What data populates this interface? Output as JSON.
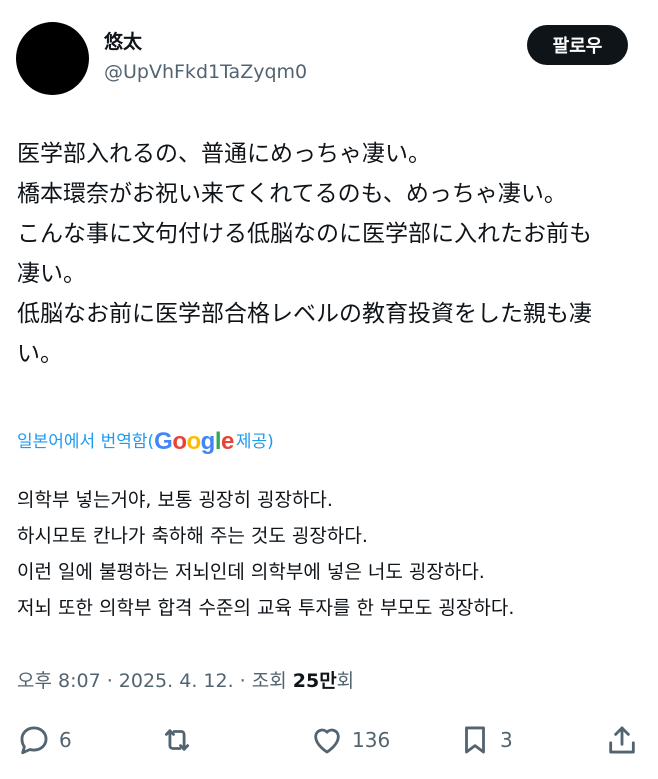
{
  "author": {
    "display_name": "悠太",
    "handle": "@UpVhFkd1TaZyqm0"
  },
  "follow_button": "팔로우",
  "tweet_lines": [
    "医学部入れるの、普通にめっちゃ凄い。",
    "橋本環奈がお祝い来てくれてるのも、めっちゃ凄い。",
    "こんな事に文句付ける低脳なのに医学部に入れたお前も",
    "凄い。",
    "低脳なお前に医学部合格レベルの教育投資をした親も凄",
    "い。"
  ],
  "translation": {
    "prefix": "일본어에서 번역함(",
    "google": [
      "G",
      "o",
      "o",
      "g",
      "l",
      "e"
    ],
    "suffix": " 제공)"
  },
  "translated_lines": [
    "의학부 넣는거야, 보통 굉장히 굉장하다.",
    "하시모토 칸나가 축하해 주는 것도 굉장하다.",
    "이런 일에 불평하는 저뇌인데 의학부에 넣은 너도 굉장하다.",
    "저뇌 또한 의학부 합격 수준의 교육 투자를 한 부모도 굉장하다."
  ],
  "meta": {
    "time": "오후 8:07",
    "date": "2025. 4. 12.",
    "views_prefix": "조회 ",
    "views_count": "25만",
    "views_suffix": "회"
  },
  "actions": {
    "replies": "6",
    "reposts": "",
    "likes": "136",
    "bookmarks": "3"
  },
  "icons": [
    "reply-icon",
    "repost-icon",
    "like-icon",
    "bookmark-icon",
    "share-icon"
  ]
}
